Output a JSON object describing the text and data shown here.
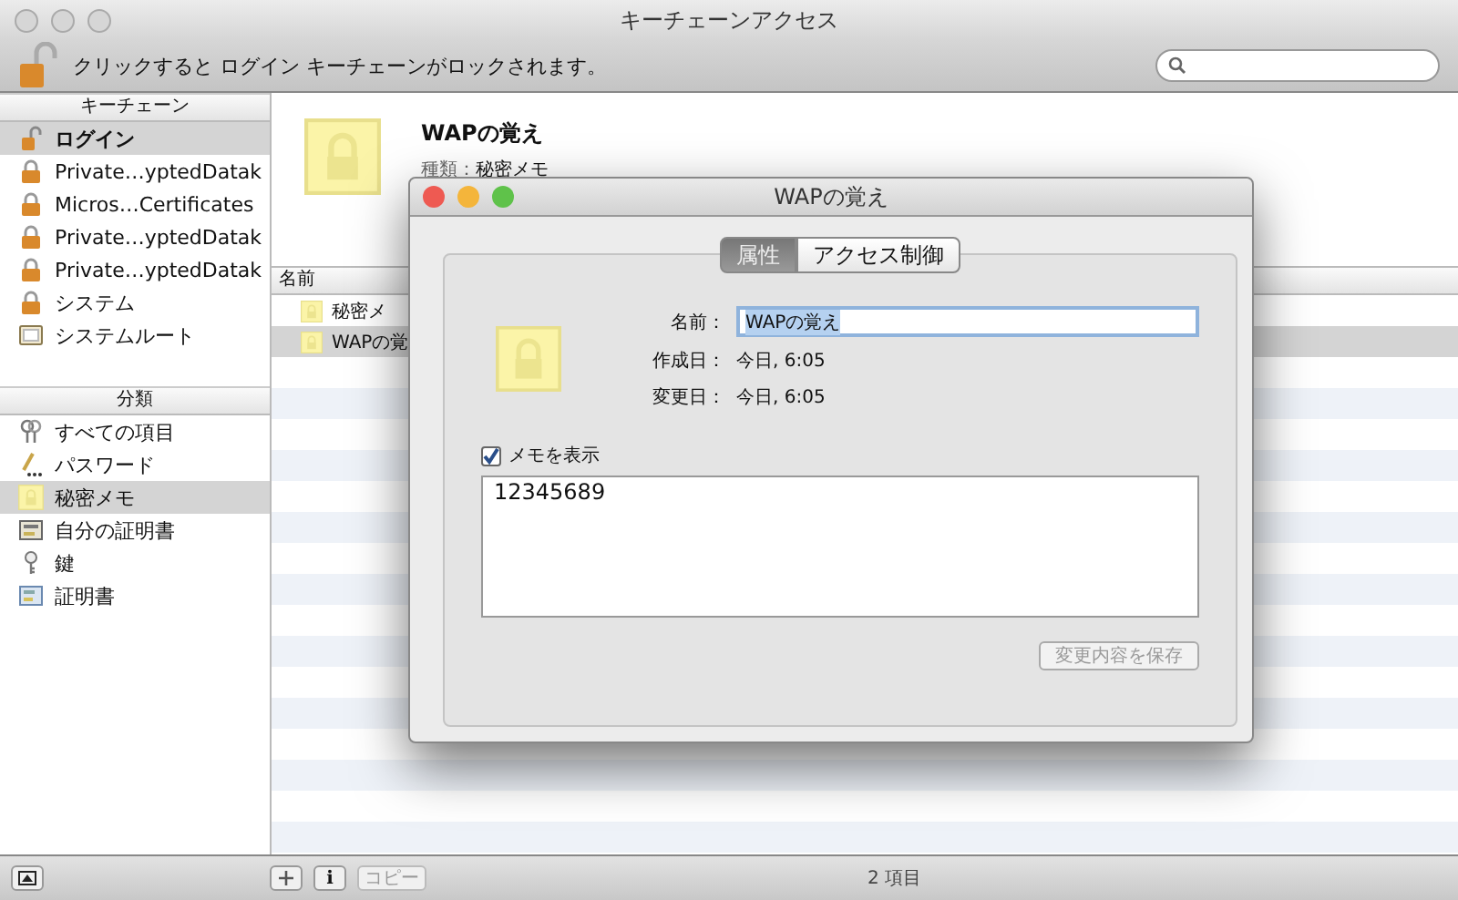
{
  "window": {
    "title": "キーチェーンアクセス"
  },
  "toolbar": {
    "lock_message": "クリックすると ログイン キーチェーンがロックされます。"
  },
  "keychains": {
    "header": "キーチェーン",
    "items": [
      {
        "label": "ログイン",
        "kind": "unlocked",
        "selected": true
      },
      {
        "label": "Private…yptedDatak",
        "kind": "locked",
        "selected": false
      },
      {
        "label": "Micros…Certificates",
        "kind": "locked",
        "selected": false
      },
      {
        "label": "Private…yptedDatak",
        "kind": "locked",
        "selected": false
      },
      {
        "label": "Private…yptedDatak",
        "kind": "locked",
        "selected": false
      },
      {
        "label": "システム",
        "kind": "locked",
        "selected": false
      },
      {
        "label": "システムルート",
        "kind": "folder",
        "selected": false
      }
    ]
  },
  "categories": {
    "header": "分類",
    "items": [
      {
        "label": "すべての項目",
        "kind": "all",
        "selected": false
      },
      {
        "label": "パスワード",
        "kind": "password",
        "selected": false
      },
      {
        "label": "秘密メモ",
        "kind": "note",
        "selected": true
      },
      {
        "label": "自分の証明書",
        "kind": "mycert",
        "selected": false
      },
      {
        "label": "鍵",
        "kind": "key",
        "selected": false
      },
      {
        "label": "証明書",
        "kind": "cert",
        "selected": false
      }
    ]
  },
  "detail": {
    "name": "WAPの覚え",
    "kind_label": "種類：",
    "kind_value": "秘密メモ"
  },
  "table": {
    "columns": [
      "名前"
    ],
    "rows": [
      {
        "name": "秘密メ",
        "selected": false
      },
      {
        "name": "WAPの覚",
        "selected": true
      }
    ]
  },
  "status_bar": {
    "info_button": "i",
    "copy_button": "コピー",
    "count": "2 項目"
  },
  "dialog": {
    "title": "WAPの覚え",
    "tabs": [
      {
        "label": "属性",
        "selected": true
      },
      {
        "label": "アクセス制御",
        "selected": false
      }
    ],
    "fields": [
      {
        "label": "名前：",
        "value": "WAPの覚え",
        "kind": "input"
      },
      {
        "label": "作成日：",
        "value": "今日, 6:05",
        "kind": "text"
      },
      {
        "label": "変更日：",
        "value": "今日, 6:05",
        "kind": "text"
      }
    ],
    "show_note": {
      "label": "メモを表示",
      "checked": true
    },
    "note": "12345689",
    "save_button": {
      "label": "変更内容を保存",
      "disabled": true
    }
  }
}
